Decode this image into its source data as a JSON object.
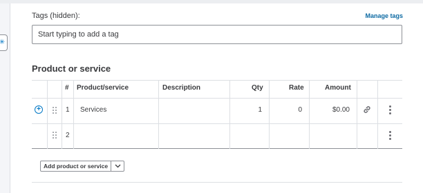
{
  "tags": {
    "label": "Tags (hidden):",
    "manage_link": "Manage tags",
    "input_placeholder": "Start typing to add a tag"
  },
  "section": {
    "title": "Product or service"
  },
  "table": {
    "headers": {
      "num": "#",
      "product": "Product/service",
      "description": "Description",
      "qty": "Qty",
      "rate": "Rate",
      "amount": "Amount"
    },
    "rows": [
      {
        "num": "1",
        "product": "Services",
        "description": "",
        "qty": "1",
        "rate": "0",
        "amount": "$0.00"
      },
      {
        "num": "2",
        "product": "",
        "description": "",
        "qty": "",
        "rate": "",
        "amount": ""
      }
    ]
  },
  "add_button": {
    "label": "Add product or service"
  },
  "icons": {
    "side_tab": "sparkle-icon",
    "add_line": "plus-circle-icon",
    "drag": "drag-handle-icon",
    "link": "link-icon",
    "more": "more-vertical-icon",
    "dropdown": "chevron-down-icon"
  },
  "colors": {
    "accent": "#0077c5",
    "link": "#0d6aa3",
    "text": "#393a3d",
    "border": "#8d9096",
    "grid": "#dcdfe3"
  }
}
